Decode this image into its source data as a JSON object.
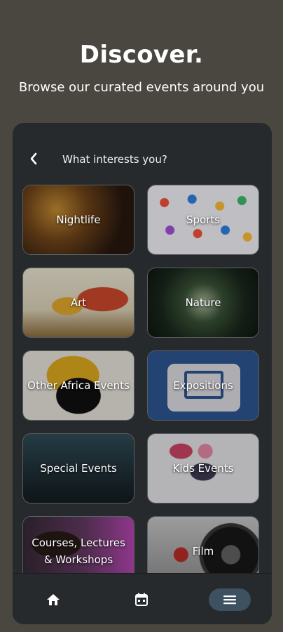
{
  "header": {
    "title": "Discover.",
    "subtitle": "Browse our curated events around you"
  },
  "panel": {
    "back_icon": "chevron-left-icon",
    "title": "What interests you?"
  },
  "categories": [
    {
      "label": "Nightlife"
    },
    {
      "label": "Sports"
    },
    {
      "label": "Art"
    },
    {
      "label": "Nature"
    },
    {
      "label": "Other Africa Events"
    },
    {
      "label": "Expositions"
    },
    {
      "label": "Special Events"
    },
    {
      "label": "Kids Events"
    },
    {
      "label": "Courses, Lectures & Workshops"
    },
    {
      "label": "Film"
    }
  ],
  "bottom_nav": [
    {
      "icon": "home-icon",
      "active": false
    },
    {
      "icon": "calendar-icon",
      "active": false
    },
    {
      "icon": "menu-icon",
      "active": true
    }
  ],
  "colors": {
    "page_background": "#4a4640",
    "panel_background": "#262a2c",
    "active_nav": "#3d5160"
  }
}
